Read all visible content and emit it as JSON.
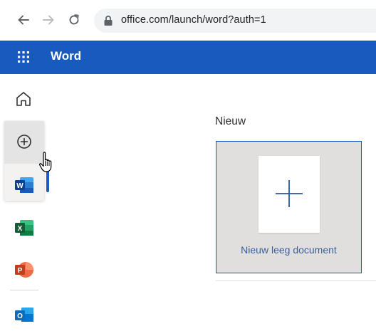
{
  "browser": {
    "url": "office.com/launch/word?auth=1"
  },
  "header": {
    "app_name": "Word",
    "color": "#185abd"
  },
  "rail": {
    "items": [
      {
        "name": "home",
        "icon": "home-icon"
      },
      {
        "name": "create",
        "icon": "add-circle-icon"
      },
      {
        "name": "word",
        "icon": "word-app-icon",
        "color": "#185abd",
        "letter": "W"
      },
      {
        "name": "excel",
        "icon": "excel-app-icon",
        "color": "#107c41",
        "letter": "X"
      },
      {
        "name": "powerpoint",
        "icon": "powerpoint-app-icon",
        "color": "#c43e1c",
        "letter": "P"
      },
      {
        "name": "outlook",
        "icon": "outlook-app-icon",
        "color": "#0f6cbd",
        "letter": "O"
      }
    ]
  },
  "main": {
    "section_title": "Nieuw",
    "new_tile": {
      "label": "Nieuw leeg document",
      "icon": "plus-icon"
    }
  }
}
